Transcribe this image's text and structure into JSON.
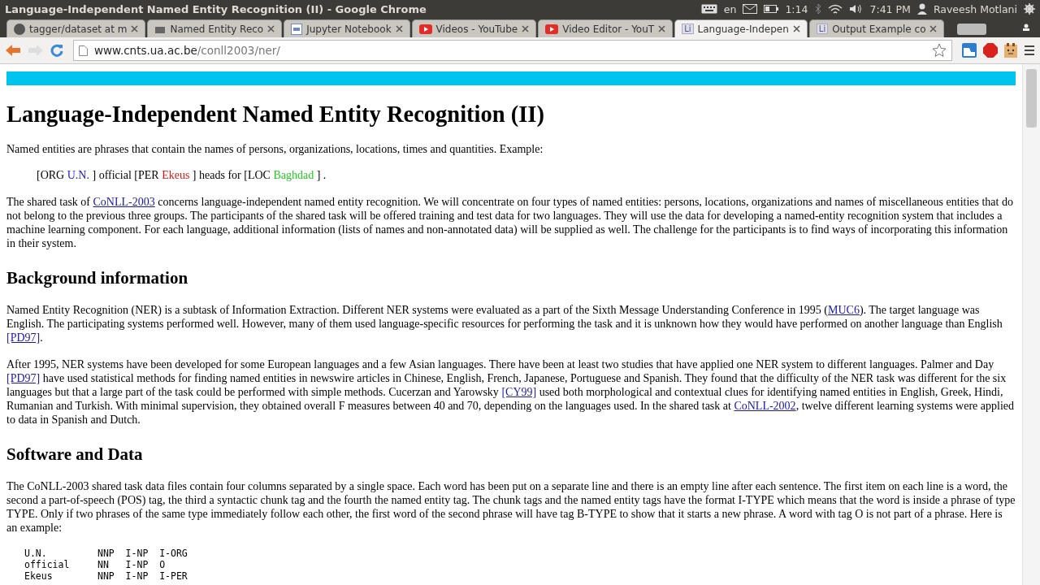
{
  "window": {
    "title": "Language-Independent Named Entity Recognition (II) - Google Chrome"
  },
  "system_tray": {
    "keyboard_layout": "en",
    "battery_time": "1:14",
    "clock": "7:41 PM",
    "user": "Raveesh Motlani"
  },
  "tabs": [
    {
      "title": "tagger/dataset at m",
      "kind": "github",
      "selected": false
    },
    {
      "title": "Named Entity Reco",
      "kind": "page",
      "selected": false
    },
    {
      "title": "Jupyter Notebook",
      "kind": "notebook",
      "selected": false
    },
    {
      "title": "Videos - YouTube",
      "kind": "youtube",
      "selected": false
    },
    {
      "title": "Video Editor - YouT",
      "kind": "youtube",
      "selected": false
    },
    {
      "title": "Language-Indepen",
      "kind": "letters",
      "icon_text": "Li",
      "selected": true
    },
    {
      "title": "Output Example co",
      "kind": "letters",
      "icon_text": "Li",
      "selected": false
    }
  ],
  "address_bar": {
    "host": "www.cnts.ua.ac.be",
    "path": "/conll2003/ner/"
  },
  "page": {
    "title": "Language-Independent Named Entity Recognition (II)",
    "blocks": [
      {
        "kind": "paragraph",
        "parts": [
          {
            "text": "Named entities are phrases that contain the names of persons, organizations, locations, times and quantities. Example:"
          }
        ]
      },
      {
        "kind": "example",
        "parts": [
          {
            "text": "[ORG "
          },
          {
            "text": "U.N.",
            "color": "#1a1acc"
          },
          {
            "text": " ] official [PER "
          },
          {
            "text": "Ekeus",
            "color": "#e01818"
          },
          {
            "text": " ] heads for [LOC "
          },
          {
            "text": "Baghdad",
            "color": "#22cc22"
          },
          {
            "text": " ] ."
          }
        ]
      },
      {
        "kind": "paragraph",
        "parts": [
          {
            "text": "The shared task of "
          },
          {
            "text": "CoNLL-2003",
            "link": true
          },
          {
            "text": " concerns language-independent named entity recognition. We will concentrate on four types of named entities: persons, locations, organizations and names of miscellaneous entities that do not belong to the previous three groups. The participants of the shared task will be offered training and test data for two languages. They will use the data for developing a named-entity recognition system that includes a machine learning component. For each language, additional information (lists of names and non-annotated data) will be supplied as well. The challenge for the participants is to find ways of incorporating this information in their system."
          }
        ]
      },
      {
        "kind": "heading",
        "parts": [
          {
            "text": "Background information"
          }
        ]
      },
      {
        "kind": "paragraph",
        "parts": [
          {
            "text": "Named Entity Recognition (NER) is a subtask of Information Extraction. Different NER systems were evaluated as a part of the Sixth Message Understanding Conference in 1995 ("
          },
          {
            "text": "MUC6",
            "link": true
          },
          {
            "text": "). The target language was English. The participating systems performed well. However, many of them used language-specific resources for performing the task and it is unknown how they would have performed on another language than English "
          },
          {
            "text": "[PD97]",
            "link": true
          },
          {
            "text": "."
          }
        ]
      },
      {
        "kind": "paragraph",
        "parts": [
          {
            "text": "After 1995, NER systems have been developed for some European languages and a few Asian languages. There have been at least two studies that have applied one NER system to different languages. Palmer and Day "
          },
          {
            "text": "[PD97]",
            "link": true
          },
          {
            "text": " have used statistical methods for finding named entities in newswire articles in Chinese, English, French, Japanese, Portuguese and Spanish. They found that the difficulty of the NER task was different for the six languages but that a large part of the task could be performed with simple methods. Cucerzan and Yarowsky "
          },
          {
            "text": "[CY99]",
            "link": true
          },
          {
            "text": " used both morphological and contextual clues for identifying named entities in English, Greek, Hindi, Rumanian and Turkish. With minimal supervision, they obtained overall F measures between 40 and 70, depending on the languages used. In the shared task at "
          },
          {
            "text": "CoNLL-2002",
            "link": true
          },
          {
            "text": ", twelve different learning systems were applied to data in Spanish and Dutch."
          }
        ]
      },
      {
        "kind": "heading",
        "parts": [
          {
            "text": "Software and Data"
          }
        ]
      },
      {
        "kind": "paragraph",
        "parts": [
          {
            "text": "The CoNLL-2003 shared task data files contain four columns separated by a single space. Each word has been put on a separate line and there is an empty line after each sentence. The first item on each line is a word, the second a part-of-speech (POS) tag, the third a syntactic chunk tag and the fourth the named entity tag. The chunk tags and the named entity tags have the format I-TYPE which means that the word is inside a phrase of type TYPE. Only if two phrases of the same type immediately follow each other, the first word of the second phrase will have tag B-TYPE to show that it starts a new phrase. A word with tag O is not part of a phrase. Here is an example:"
          }
        ]
      },
      {
        "kind": "code",
        "rows": [
          [
            "U.N.",
            "NNP",
            "I-NP",
            "I-ORG"
          ],
          [
            "official",
            "NN",
            "I-NP",
            "O"
          ],
          [
            "Ekeus",
            "NNP",
            "I-NP",
            "I-PER"
          ]
        ]
      }
    ]
  }
}
